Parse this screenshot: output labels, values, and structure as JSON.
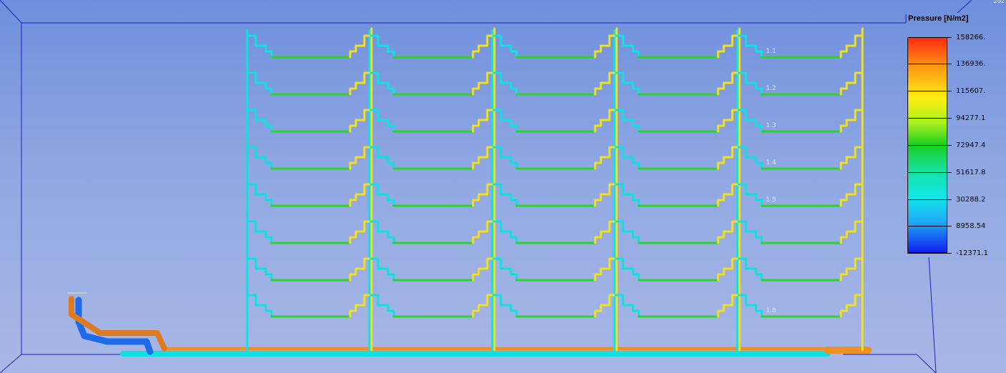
{
  "legend": {
    "title": "Pressure [N/m2]",
    "values": [
      "158266.",
      "136936.",
      "115607.",
      "94277.1",
      "72947.4",
      "51617.8",
      "30288.2",
      "8958.54",
      "-12371.1"
    ]
  },
  "corner_text": "202",
  "row_labels": [
    "1.1",
    "1.2",
    "1.3",
    "1.4",
    "1.5",
    "",
    "",
    "1.8"
  ],
  "colors": {
    "low": "#1020f0",
    "cyan": "#10e0e0",
    "green": "#30d030",
    "yellow": "#f0e020",
    "orange": "#f09020",
    "high": "#ff3010",
    "background_top": "#6e8fdc",
    "background_bottom": "#a8b8e6"
  }
}
